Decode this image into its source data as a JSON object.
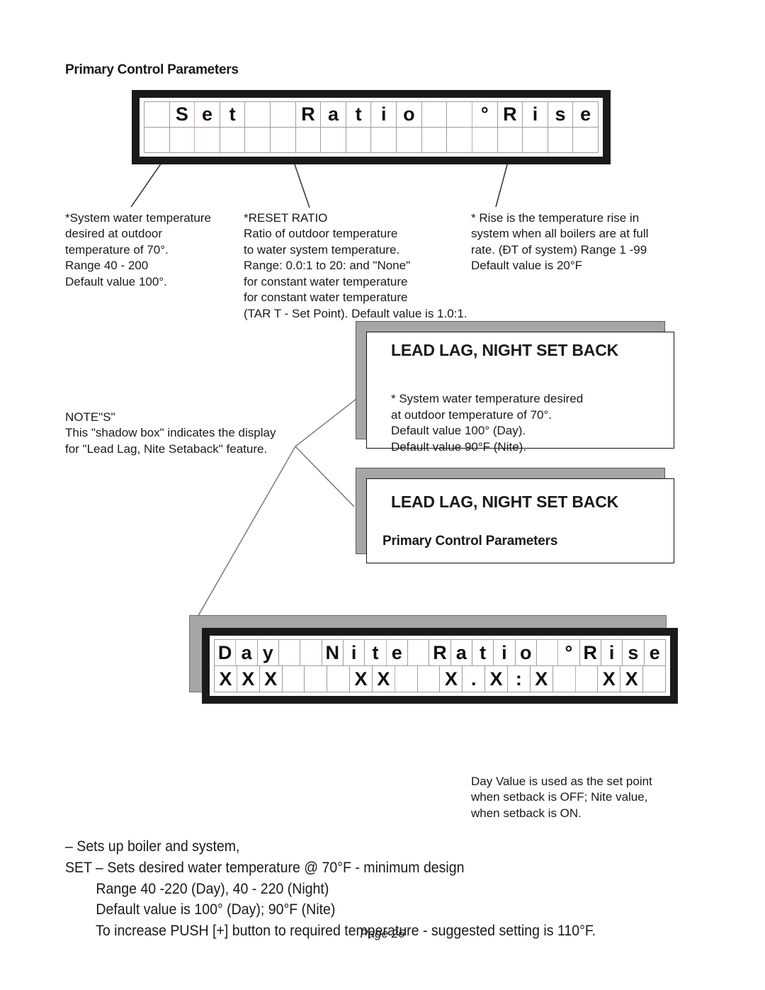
{
  "page": {
    "footer": "Page 26"
  },
  "top_section": {
    "heading": "Primary Control Parameters"
  },
  "top_lcd": {
    "name": "Set / Ratio / Rise display",
    "columns": 18,
    "row1": [
      "",
      "S",
      "e",
      "t",
      "",
      "",
      "R",
      "a",
      "t",
      "i",
      "o",
      "",
      "",
      "°",
      "R",
      "i",
      "s",
      "e"
    ],
    "row2": [
      "",
      "",
      "",
      "",
      "",
      "",
      "",
      "",
      "",
      "",
      "",
      "",
      "",
      "",
      "",
      "",
      "",
      ""
    ]
  },
  "bottom_lcd": {
    "name": "Day / Nite / Ratio / Rise display",
    "columns": 18,
    "row1": [
      "D",
      "a",
      "y",
      "",
      "N",
      "i",
      "t",
      "e",
      "",
      "R",
      "a",
      "t",
      "i",
      "o",
      "°",
      "R",
      "i",
      "s",
      "e"
    ],
    "row2": [
      "X",
      "X",
      "X",
      "",
      "",
      "",
      "X",
      "X",
      "",
      "",
      "X",
      ".",
      "X",
      ":",
      "X",
      "",
      "",
      "X",
      "X",
      ""
    ]
  },
  "bottom_lcd_cells": {
    "row1": [
      "D",
      "a",
      "y",
      "",
      "",
      "N",
      "i",
      "t",
      "e",
      "",
      "R",
      "a",
      "t",
      "i",
      "o",
      "",
      "°",
      "R",
      "i",
      "s",
      "e"
    ],
    "row2": [
      "X",
      "X",
      "X",
      "",
      "",
      "",
      "X",
      "X",
      "",
      "",
      "X",
      ".",
      "X",
      ":",
      "X",
      "",
      "",
      "X",
      "X",
      ""
    ]
  },
  "callouts": {
    "set": "*System water temperature\ndesired at outdoor\ntemperature of 70°.\nRange 40 - 200\nDefault value 100°.",
    "ratio": "*RESET RATIO\nRatio of outdoor temperature\nto water system temperature.\nRange: 0.0:1 to 20: and \"None\"\nfor constant water temperature\nfor constant water temperature\n(TAR T - Set Point). Default  value is 1.0:1.",
    "rise": "* Rise is the temperature rise in\nsystem when all boilers are at full\nrate. (ÐT of system)  Range 1 -99\nDefault value is 20°F"
  },
  "notes": {
    "text": "NOTE\"S\"\nThis \"shadow box\" indicates the display\nfor \"Lead Lag, Nite Setaback\" feature."
  },
  "shadow_box_1": {
    "title": "LEAD LAG, NIGHT SET BACK",
    "body": "* System water temperature desired\nat outdoor temperature of 70°.\nDefault value 100° (Day).\nDefault value 90°F (Nite)."
  },
  "shadow_box_2": {
    "title": "LEAD LAG, NIGHT SET BACK",
    "subtitle": "Primary Control Parameters"
  },
  "day_value_note": {
    "text": "Day Value is used as the set point\nwhen setback is OFF;  Nite value,\nwhen setback is ON."
  },
  "instructions": {
    "line1": "– Sets up boiler and system,",
    "line2": "SET – Sets desired water temperature @ 70°F - minimum design",
    "line3": "        Range 40 -220 (Day), 40 - 220 (Night)",
    "line4": "        Default value is 100° (Day); 90°F (Nite)",
    "line5": "        To increase PUSH [+] button to required temperature - suggested setting is 110°F."
  }
}
